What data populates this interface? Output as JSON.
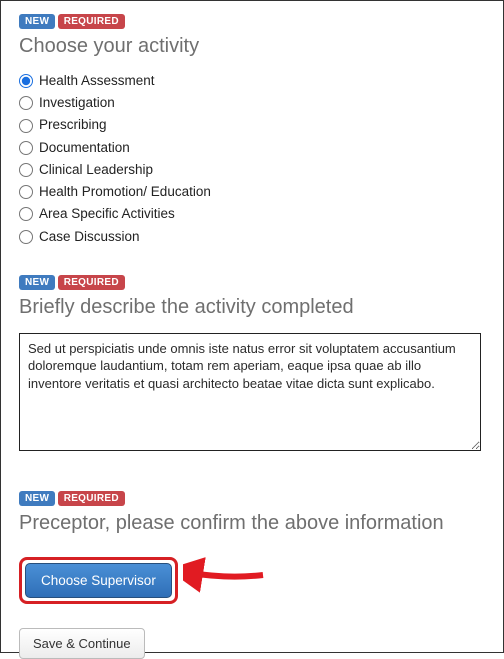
{
  "badges": {
    "new": "NEW",
    "required": "REQUIRED"
  },
  "section1": {
    "title": "Choose your activity",
    "options": [
      "Health Assessment",
      "Investigation",
      "Prescribing",
      "Documentation",
      "Clinical Leadership",
      "Health Promotion/ Education",
      "Area Specific Activities",
      "Case Discussion"
    ],
    "selected_index": 0
  },
  "section2": {
    "title": "Briefly describe the activity completed",
    "value": "Sed ut perspiciatis unde omnis iste natus error sit voluptatem accusantium doloremque laudantium, totam rem aperiam, eaque ipsa quae ab illo inventore veritatis et quasi architecto beatae vitae dicta sunt explicabo."
  },
  "section3": {
    "title": "Preceptor, please confirm the above information",
    "button_label": "Choose Supervisor"
  },
  "footer": {
    "save_continue": "Save & Continue"
  },
  "colors": {
    "highlight": "#d62024",
    "primary": "#3a7bc0"
  }
}
